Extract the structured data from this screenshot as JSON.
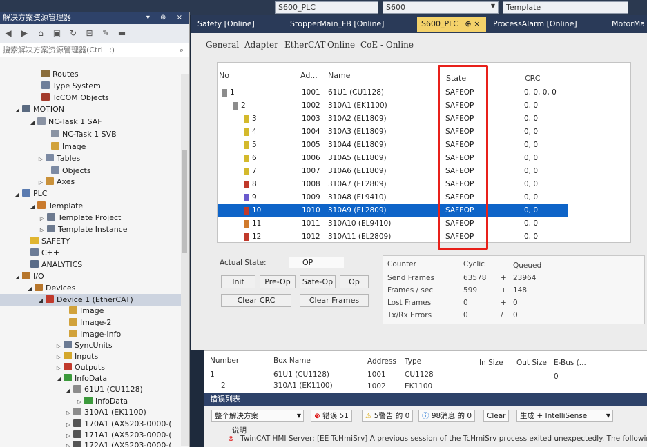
{
  "toolbar": {
    "config_combo": "S600_PLC",
    "platform_combo": "S600",
    "template_combo": "Template"
  },
  "explorer": {
    "title": "解决方案资源管理器",
    "search_placeholder": "搜索解决方案资源管理器(Ctrl+;)",
    "tree": [
      {
        "label": "Routes",
        "icon": "routes-icon",
        "color": "#8a6d3b"
      },
      {
        "label": "Type System",
        "icon": "type-system-icon",
        "color": "#6f7f9a"
      },
      {
        "label": "TcCOM Objects",
        "icon": "tccom-icon",
        "color": "#a33b2b"
      },
      {
        "label": "MOTION",
        "icon": "motion-icon",
        "color": "#5a6a80"
      },
      {
        "label": "NC-Task 1 SAF",
        "icon": "nc-task-icon",
        "color": "#8a93a3"
      },
      {
        "label": "NC-Task 1 SVB",
        "icon": "nc-task-icon",
        "color": "#8a93a3"
      },
      {
        "label": "Image",
        "icon": "image-icon",
        "color": "#d1a23b"
      },
      {
        "label": "Tables",
        "icon": "tables-icon",
        "color": "#7c8aa3"
      },
      {
        "label": "Objects",
        "icon": "objects-icon",
        "color": "#7c8aa3"
      },
      {
        "label": "Axes",
        "icon": "axes-icon",
        "color": "#c9913a"
      },
      {
        "label": "PLC",
        "icon": "plc-icon",
        "color": "#5a7bb0"
      },
      {
        "label": "Template",
        "icon": "template-icon",
        "color": "#c97a2d"
      },
      {
        "label": "Template Project",
        "icon": "plc-project-icon",
        "color": "#6d7a8f"
      },
      {
        "label": "Template Instance",
        "icon": "plc-instance-icon",
        "color": "#6d7a8f"
      },
      {
        "label": "SAFETY",
        "icon": "safety-icon",
        "color": "#e0b530"
      },
      {
        "label": "C++",
        "icon": "cpp-icon",
        "color": "#6c7c96"
      },
      {
        "label": "ANALYTICS",
        "icon": "analytics-icon",
        "color": "#5a6c88"
      },
      {
        "label": "I/O",
        "icon": "io-icon",
        "color": "#b7762c"
      },
      {
        "label": "Devices",
        "icon": "devices-icon",
        "color": "#b7762c"
      },
      {
        "label": "Device 1 (EtherCAT)",
        "icon": "ethercat-device-icon",
        "color": "#c0392b"
      },
      {
        "label": "Image",
        "icon": "image-icon",
        "color": "#d1a23b"
      },
      {
        "label": "Image-2",
        "icon": "image-icon",
        "color": "#d1a23b"
      },
      {
        "label": "Image-Info",
        "icon": "image-icon",
        "color": "#d1a23b"
      },
      {
        "label": "SyncUnits",
        "icon": "syncunits-icon",
        "color": "#6b7a93"
      },
      {
        "label": "Inputs",
        "icon": "inputs-icon",
        "color": "#d4a72c"
      },
      {
        "label": "Outputs",
        "icon": "outputs-icon",
        "color": "#c0392b"
      },
      {
        "label": "InfoData",
        "icon": "infodata-icon",
        "color": "#3c9a3c"
      },
      {
        "label": "61U1 (CU1128)",
        "icon": "terminal-icon",
        "color": "#8c8c8c"
      },
      {
        "label": "InfoData",
        "icon": "infodata-icon",
        "color": "#3c9a3c"
      },
      {
        "label": "310A1 (EK1100)",
        "icon": "terminal-icon",
        "color": "#8c8c8c"
      },
      {
        "label": "170A1 (AX5203-0000-(",
        "icon": "drive-icon",
        "color": "#555"
      },
      {
        "label": "171A1 (AX5203-0000-(",
        "icon": "drive-icon",
        "color": "#555"
      },
      {
        "label": "172A1 (AX5203-0000-(",
        "icon": "drive-icon",
        "color": "#555"
      }
    ]
  },
  "tabs": [
    {
      "label": "Safety [Online]"
    },
    {
      "label": "StopperMain_FB [Online]"
    },
    {
      "label": "S600_PLC"
    },
    {
      "label": "ProcessAlarm [Online]"
    },
    {
      "label": "MotorMa"
    }
  ],
  "tab_pin": "⊕ ×",
  "subtabs": [
    "General",
    "Adapter",
    "EtherCAT",
    "Online",
    "CoE - Online"
  ],
  "grid": {
    "headers": {
      "no": "No",
      "addr": "Ad...",
      "name": "Name",
      "state": "State",
      "crc": "CRC"
    },
    "rows": [
      {
        "no": "1",
        "addr": "1001",
        "name": "61U1 (CU1128)",
        "state": "SAFEOP",
        "crc": "0, 0, 0, 0",
        "icon_color": "#8c8c8c"
      },
      {
        "no": "2",
        "addr": "1002",
        "name": "310A1 (EK1100)",
        "state": "SAFEOP",
        "crc": "0, 0",
        "icon_color": "#8c8c8c"
      },
      {
        "no": "3",
        "addr": "1003",
        "name": "310A2 (EL1809)",
        "state": "SAFEOP",
        "crc": "0, 0",
        "icon_color": "#d4b92c"
      },
      {
        "no": "4",
        "addr": "1004",
        "name": "310A3 (EL1809)",
        "state": "SAFEOP",
        "crc": "0, 0",
        "icon_color": "#d4b92c"
      },
      {
        "no": "5",
        "addr": "1005",
        "name": "310A4 (EL1809)",
        "state": "SAFEOP",
        "crc": "0, 0",
        "icon_color": "#d4b92c"
      },
      {
        "no": "6",
        "addr": "1006",
        "name": "310A5 (EL1809)",
        "state": "SAFEOP",
        "crc": "0, 0",
        "icon_color": "#d4b92c"
      },
      {
        "no": "7",
        "addr": "1007",
        "name": "310A6 (EL1809)",
        "state": "SAFEOP",
        "crc": "0, 0",
        "icon_color": "#d4b92c"
      },
      {
        "no": "8",
        "addr": "1008",
        "name": "310A7 (EL2809)",
        "state": "SAFEOP",
        "crc": "0, 0",
        "icon_color": "#c0392b"
      },
      {
        "no": "9",
        "addr": "1009",
        "name": "310A8 (EL9410)",
        "state": "SAFEOP",
        "crc": "0, 0",
        "icon_color": "#6a5acd"
      },
      {
        "no": "10",
        "addr": "1010",
        "name": "310A9 (EL2809)",
        "state": "SAFEOP",
        "crc": "0, 0",
        "icon_color": "#c0392b"
      },
      {
        "no": "11",
        "addr": "1011",
        "name": "310A10 (EL9410)",
        "state": "SAFEOP",
        "crc": "0, 0",
        "icon_color": "#d07a2c"
      },
      {
        "no": "12",
        "addr": "1012",
        "name": "310A11 (EL2809)",
        "state": "SAFEOP",
        "crc": "0, 0",
        "icon_color": "#c0392b"
      }
    ],
    "selected_row": 9
  },
  "state_panel": {
    "actual_state_label": "Actual State:",
    "actual_state_value": "OP",
    "init_label": "Init",
    "preop_label": "Pre-Op",
    "safeop_label": "Safe-Op",
    "op_label": "Op",
    "clear_crc_label": "Clear CRC",
    "clear_frames_label": "Clear Frames"
  },
  "counters": {
    "h_counter": "Counter",
    "h_cyclic": "Cyclic",
    "h_queued": "Queued",
    "rows": [
      {
        "label": "Send Frames",
        "cyclic": "63578",
        "sep": "+",
        "queued": "23964"
      },
      {
        "label": "Frames / sec",
        "cyclic": "599",
        "sep": "+",
        "queued": "148"
      },
      {
        "label": "Lost Frames",
        "cyclic": "0",
        "sep": "+",
        "queued": "0"
      },
      {
        "label": "Tx/Rx Errors",
        "cyclic": "0",
        "sep": "/",
        "queued": "0"
      }
    ]
  },
  "lower_grid": {
    "headers": {
      "number": "Number",
      "box_name": "Box Name",
      "address": "Address",
      "type": "Type",
      "in_size": "In Size",
      "out_size": "Out Size",
      "ebus": "E-Bus (..."
    },
    "rows": [
      {
        "number": "1",
        "box_name": "61U1 (CU1128)",
        "address": "1001",
        "type": "CU1128",
        "ebus": "0"
      },
      {
        "number": "2",
        "box_name": "310A1 (EK1100)",
        "address": "1002",
        "type": "EK1100",
        "ebus": ""
      }
    ]
  },
  "error_list": {
    "title": "错误列表",
    "scope": "整个解决方案",
    "errors": "错误 51",
    "warnings": "5警告 的 0",
    "messages": "98消息 的 0",
    "clear": "Clear",
    "build": "生成 + IntelliSense",
    "col_desc": "说明",
    "message": "TwinCAT HMI Server: [EE TcHmiSrv] A previous session of the TcHmiSrv process exited unexpectedly. The following"
  }
}
